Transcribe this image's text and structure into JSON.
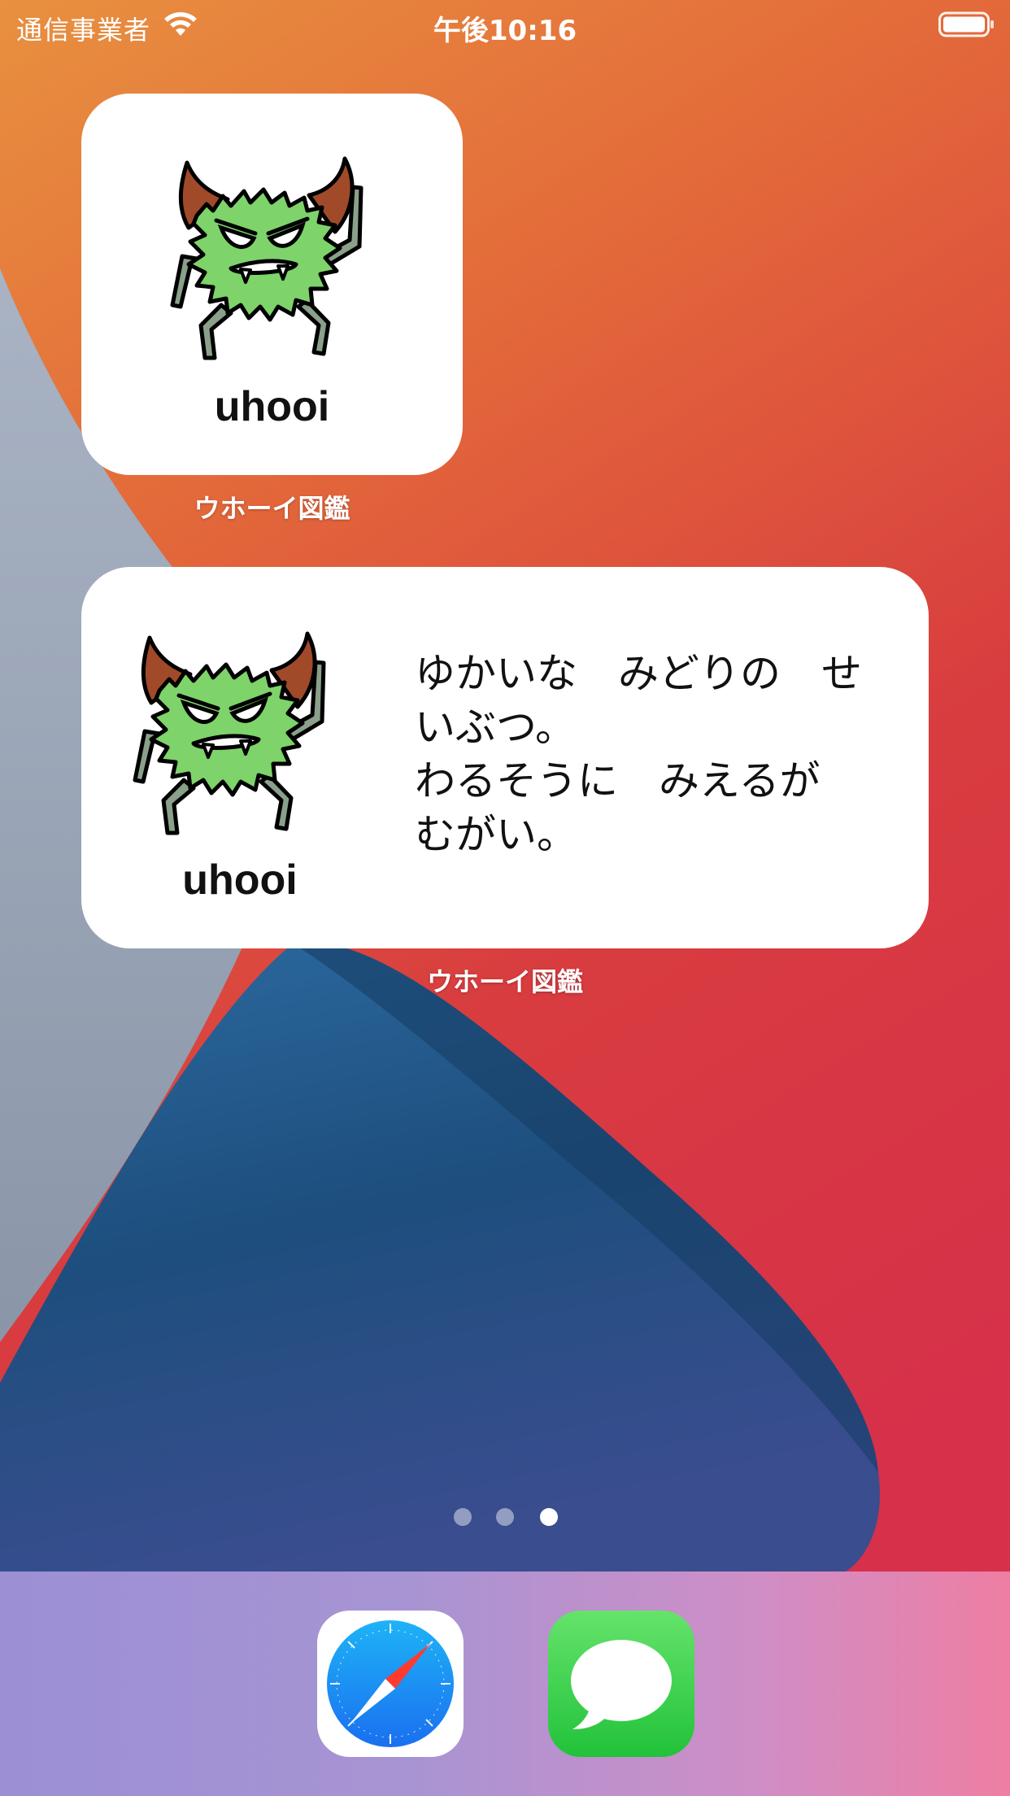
{
  "status_bar": {
    "carrier": "通信事業者",
    "time": "午後10:16",
    "wifi_icon": "wifi-icon",
    "battery_icon": "battery-icon"
  },
  "widgets": {
    "small": {
      "name": "uhooi",
      "app_label": "ウホーイ図鑑",
      "image_icon": "monster-image"
    },
    "medium": {
      "name": "uhooi",
      "description": "ゆかいな　みどりの　せいぶつ。\nわるそうに　みえるが　むがい。",
      "app_label": "ウホーイ図鑑",
      "image_icon": "monster-image"
    }
  },
  "page_indicator": {
    "count": 3,
    "current": 3
  },
  "dock": {
    "apps": [
      {
        "icon": "safari-icon"
      },
      {
        "icon": "messages-icon"
      }
    ]
  },
  "colors": {
    "wallpaper_orange": "#e8813c",
    "wallpaper_red": "#d8393e",
    "wallpaper_blue": "#1f4e79",
    "widget_bg": "#ffffff",
    "monster_green": "#7ed36a"
  }
}
